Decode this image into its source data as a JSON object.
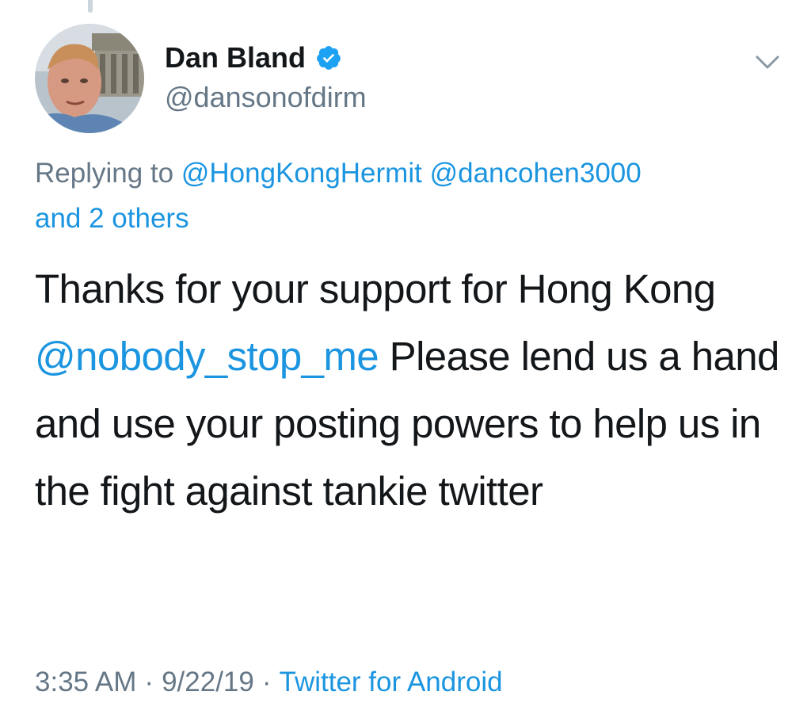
{
  "tweet": {
    "author": {
      "display_name": "Dan Bland",
      "handle": "@dansonofdirm",
      "verified": true
    },
    "reply_context": {
      "prefix": "Replying to",
      "mentions": [
        "@HongKongHermit",
        "@dancohen3000"
      ],
      "others": "and 2 others"
    },
    "body": {
      "part1": "Thanks for your support for Hong Kong",
      "mention": "@nobody_stop_me",
      "part2": "Please lend us a hand and use your posting powers to help us in the fight against tankie twitter"
    },
    "meta": {
      "time": "3:35 AM",
      "date": "9/22/19",
      "separator": "·",
      "source": "Twitter for Android"
    },
    "colors": {
      "link": "#1b95e0",
      "secondary_text": "#657786",
      "primary_text": "#14171a",
      "verified_badge": "#1da1f2"
    },
    "icons": {
      "verified": "verified-badge-icon",
      "menu": "chevron-down-icon"
    }
  }
}
